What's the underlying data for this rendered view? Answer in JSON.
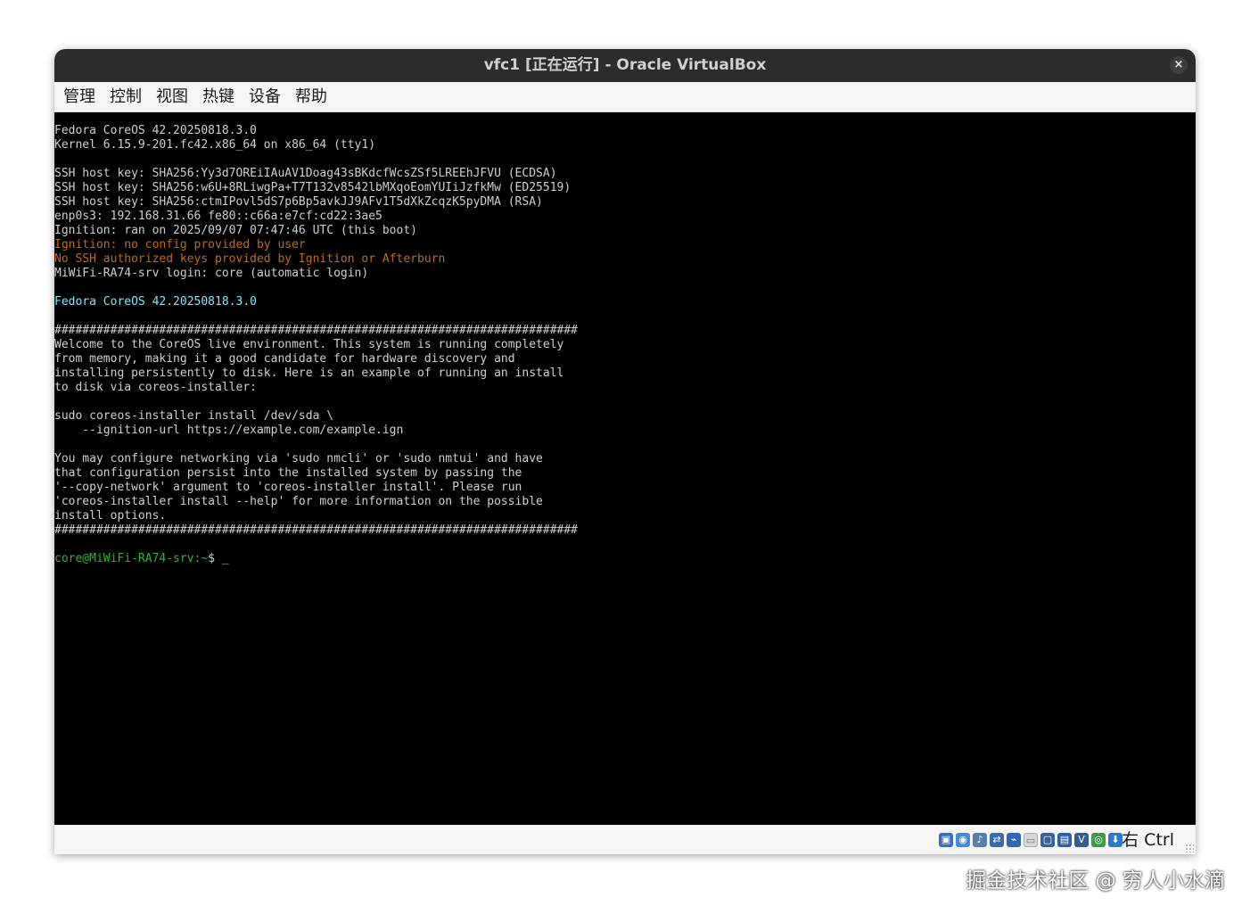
{
  "window": {
    "title": "vfc1 [正在运行] - Oracle VirtualBox",
    "close_glyph": "×"
  },
  "menubar": {
    "items": [
      "管理",
      "控制",
      "视图",
      "热键",
      "设备",
      "帮助"
    ]
  },
  "terminal": {
    "lines": [
      "Fedora CoreOS 42.20250818.3.0",
      "Kernel 6.15.9-201.fc42.x86_64 on x86_64 (tty1)",
      "",
      "SSH host key: SHA256:Yy3d7OREiIAuAV1Doag43sBKdcfWcsZSf5LREEhJFVU (ECDSA)",
      "SSH host key: SHA256:w6U+8RLiwgPa+T7T132v8542lbMXqoEomYUIiJzfkMw (ED25519)",
      "SSH host key: SHA256:ctmIPovl5dS7p6Bp5avkJJ9AFv1T5dXkZcqzK5pyDMA (RSA)",
      "enp0s3: 192.168.31.66 fe80::c66a:e7cf:cd22:3ae5",
      "Ignition: ran on 2025/09/07 07:47:46 UTC (this boot)",
      "Ignition: no config provided by user",
      "No SSH authorized keys provided by Ignition or Afterburn",
      "MiWiFi-RA74-srv login: core (automatic login)",
      "",
      "Fedora CoreOS 42.20250818.3.0",
      "",
      "###########################################################################",
      "Welcome to the CoreOS live environment. This system is running completely",
      "from memory, making it a good candidate for hardware discovery and",
      "installing persistently to disk. Here is an example of running an install",
      "to disk via coreos-installer:",
      "",
      "sudo coreos-installer install /dev/sda \\",
      "    --ignition-url https://example.com/example.ign",
      "",
      "You may configure networking via 'sudo nmcli' or 'sudo nmtui' and have",
      "that configuration persist into the installed system by passing the",
      "'--copy-network' argument to 'coreos-installer install'. Please run",
      "'coreos-installer install --help' for more information on the possible",
      "install options.",
      "###########################################################################",
      "",
      "core@MiWiFi-RA74-srv:~$ _"
    ],
    "line_colors": {
      "8": "orange",
      "9": "orange",
      "12": "cyan"
    },
    "prompt": "core@MiWiFi-RA74-srv:~",
    "prompt_suffix": "$ _"
  },
  "statusbar": {
    "icons": [
      "hard-disk-icon",
      "optical-drive-icon",
      "audio-icon",
      "network-icon",
      "usb-icon",
      "shared-folders-icon",
      "display-icon",
      "video-capture-icon",
      "cpu-icon",
      "mouse-integration-icon",
      "keyboard-icon"
    ],
    "host_key": "右 Ctrl"
  },
  "watermark": "掘金技术社区 @ 穷人小水滴",
  "colors": {
    "titlebar": "#2c2c2c",
    "terminal_bg": "#000000",
    "terminal_fg": "#cfcfcf",
    "orange": "#c06a1a",
    "cyan": "#7ee6ff",
    "green": "#2fb52f"
  }
}
